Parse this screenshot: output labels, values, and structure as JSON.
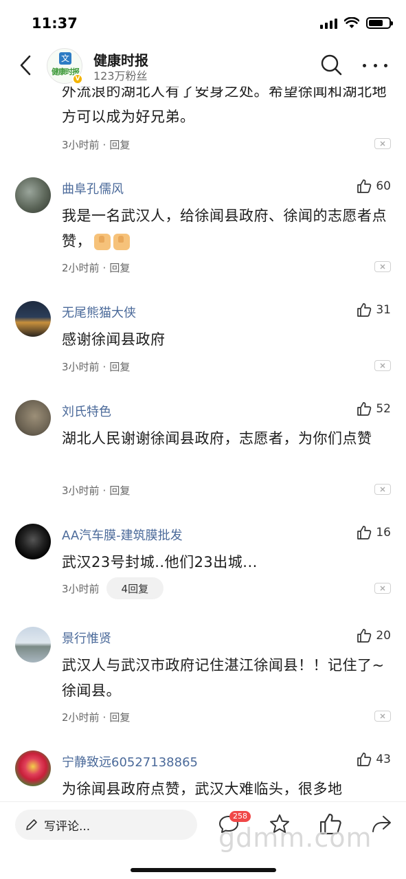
{
  "status_bar": {
    "time": "11:37"
  },
  "header": {
    "account_name": "健康时报",
    "fans": "123万粉丝",
    "logo_text": "健康时报"
  },
  "comments": [
    {
      "name": "",
      "text": "外流浪的湖北人有了安身之处。希望徐闻和湖北地方可以成为好兄弟。",
      "time": "3小时前",
      "reply": "回复"
    },
    {
      "name": "曲阜孔儒风",
      "likes": "60",
      "text": "我是一名武汉人，给徐闻县政府、徐闻的志愿者点赞，",
      "time": "2小时前",
      "reply": "回复"
    },
    {
      "name": "无尾熊猫大侠",
      "likes": "31",
      "text": "感谢徐闻县政府",
      "time": "3小时前",
      "reply": "回复"
    },
    {
      "name": "刘氏特色",
      "likes": "52",
      "text": "湖北人民谢谢徐闻县政府，志愿者，为你们点赞",
      "time": "3小时前",
      "reply": "回复"
    },
    {
      "name": "AA汽车膜-建筑膜批发",
      "likes": "16",
      "text": "武汉23号封城..他们23出城...",
      "time": "3小时前",
      "reply": "4回复"
    },
    {
      "name": "景行惟贤",
      "likes": "20",
      "text": "武汉人与武汉市政府记住湛江徐闻县！！记住了~徐闻县。",
      "time": "2小时前",
      "reply": "回复"
    },
    {
      "name": "宁静致远60527138865",
      "likes": "43",
      "text": "为徐闻县政府点赞，武汉大难临头，很多地"
    }
  ],
  "bottom_bar": {
    "input_placeholder": "写评论...",
    "comment_count": "258",
    "watermark": "gdmm.com"
  },
  "colors": {
    "name_blue": "#4b6a9a",
    "badge_red": "#f04848",
    "text_dark": "#1c1c1c"
  },
  "icons": [
    "back-arrow-icon",
    "search-icon",
    "more-icon",
    "thumb-up-icon",
    "close-icon",
    "pencil-icon",
    "comment-icon",
    "star-icon",
    "share-icon"
  ]
}
